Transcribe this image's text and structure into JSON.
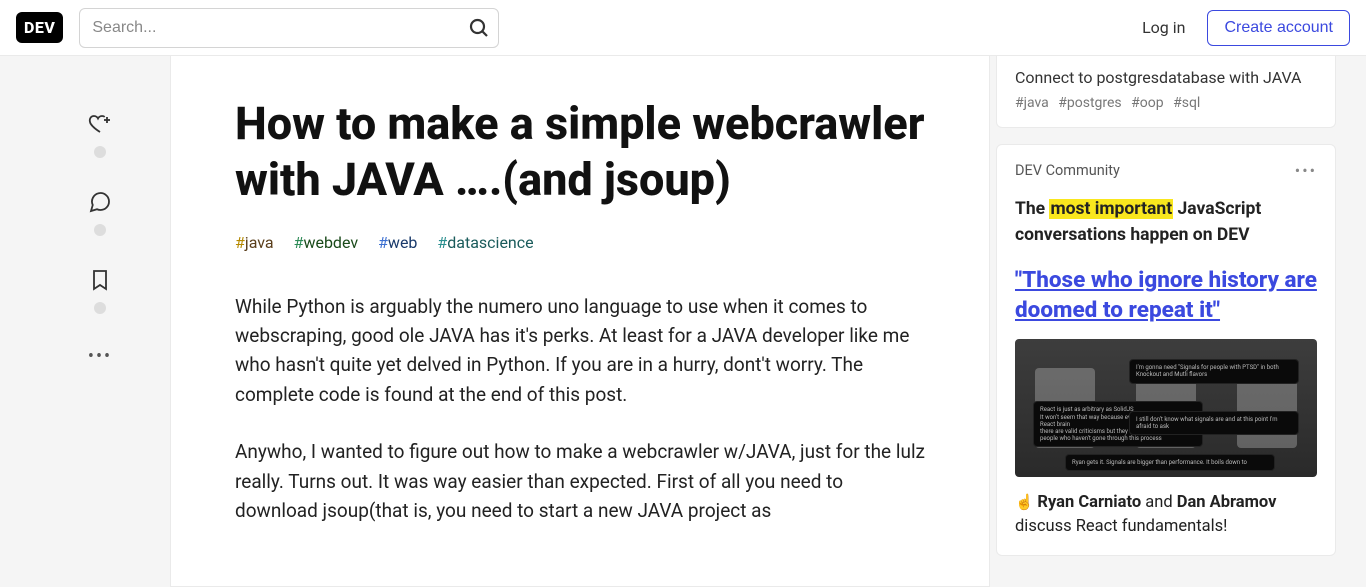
{
  "header": {
    "logo": "DEV",
    "search_placeholder": "Search...",
    "login": "Log in",
    "create": "Create account"
  },
  "article": {
    "title": "How to make a simple webcrawler with JAVA ….(and jsoup)",
    "tags": [
      "java",
      "webdev",
      "web",
      "datascience"
    ],
    "p1": "While Python is arguably the numero uno language to use when it comes to webscraping, good ole JAVA has it's perks. At least for a JAVA developer like me who hasn't quite yet delved in Python. If you are in a hurry, dont't worry. The complete code is found at the end of this post.",
    "p2": "Anywho, I wanted to figure out how to make a webcrawler w/JAVA, just for the lulz really. Turns out. It was way easier than expected. First of all you need to download jsoup(that is, you need to start a new JAVA project as"
  },
  "sidebar": {
    "related": {
      "title": "Connect to postgresdatabase with JAVA",
      "tags": [
        "#java",
        "#postgres",
        "#oop",
        "#sql"
      ]
    },
    "community": {
      "label": "DEV Community",
      "blurb_pre": "The ",
      "blurb_hl": "most important",
      "blurb_post": " JavaScript conversations happen on DEV",
      "link": "\"Those who ignore history are doomed to repeat it\"",
      "foot_emoji": "☝️ ",
      "foot_name1": "Ryan Carniato",
      "foot_mid": " and ",
      "foot_name2": "Dan Abramov",
      "foot_tail": " discuss React fundamentals!"
    }
  }
}
